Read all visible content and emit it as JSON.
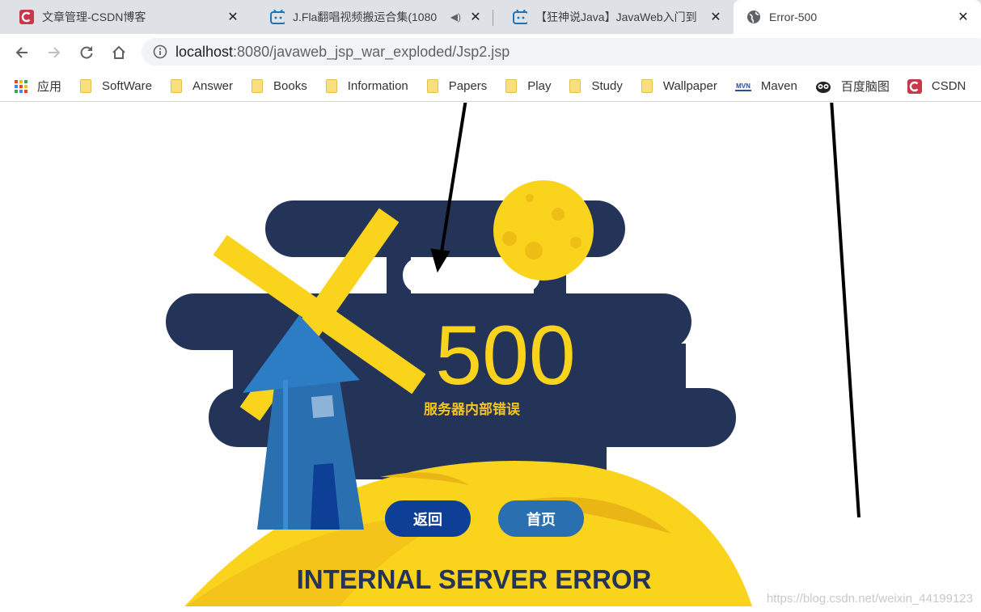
{
  "tabs": [
    {
      "title": "文章管理-CSDN博客",
      "icon": "csdn-icon"
    },
    {
      "title": "J.Fla翻唱视频搬运合集(1080",
      "icon": "bilibili-icon"
    },
    {
      "title": "【狂神说Java】JavaWeb入门到",
      "icon": "bilibili-icon"
    },
    {
      "title": "Error-500",
      "icon": "globe-icon"
    }
  ],
  "omnibox": {
    "host": "localhost",
    "path": ":8080/javaweb_jsp_war_exploded/Jsp2.jsp"
  },
  "bookmarks": [
    {
      "label": "应用",
      "icon": "apps-grid-icon"
    },
    {
      "label": "SoftWare",
      "icon": "folder-icon"
    },
    {
      "label": "Answer",
      "icon": "folder-icon"
    },
    {
      "label": "Books",
      "icon": "folder-icon"
    },
    {
      "label": "Information",
      "icon": "folder-icon"
    },
    {
      "label": "Papers",
      "icon": "folder-icon"
    },
    {
      "label": "Play",
      "icon": "folder-icon"
    },
    {
      "label": "Study",
      "icon": "folder-icon"
    },
    {
      "label": "Wallpaper",
      "icon": "folder-icon"
    },
    {
      "label": "Maven",
      "icon": "mvn-icon"
    },
    {
      "label": "百度脑图",
      "icon": "owl-icon"
    },
    {
      "label": "CSDN",
      "icon": "csdn-icon"
    }
  ],
  "error_page": {
    "code": "500",
    "subtitle": "服务器内部错误",
    "back_button": "返回",
    "home_button": "首页",
    "banner": "INTERNAL SERVER ERROR"
  },
  "watermark": "https://blog.csdn.net/weixin_44199123",
  "colors": {
    "navy": "#243459",
    "yellow": "#f9d31c",
    "blue": "#2a6faf",
    "dark_blue": "#0e3f96"
  }
}
